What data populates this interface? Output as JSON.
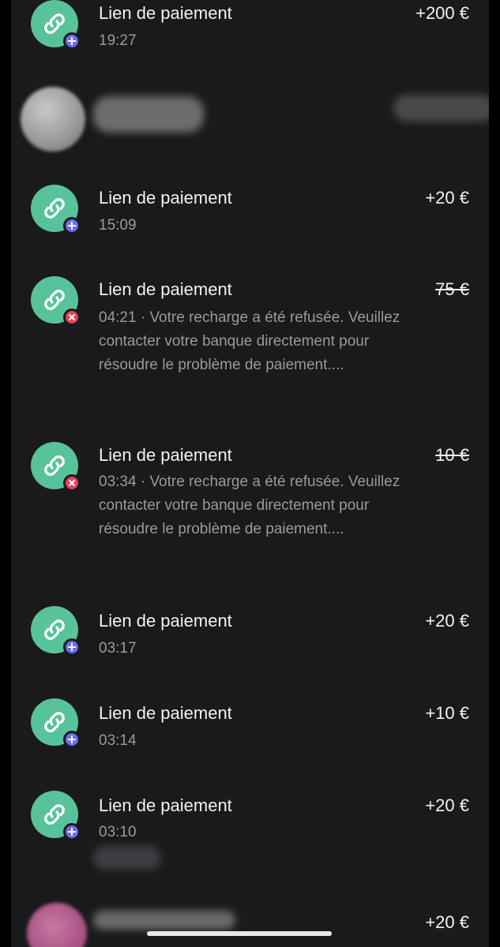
{
  "transactions": [
    {
      "title": "Lien de paiement",
      "time": "19:27",
      "amount": "+200 €",
      "status": "credit"
    },
    {
      "title": "Lien de paiement",
      "time": "15:09",
      "amount": "+20 €",
      "status": "credit"
    },
    {
      "title": "Lien de paiement",
      "time": "04:21",
      "message": "Votre recharge a été refusée. Veuillez contacter votre banque directement pour résoudre le problème de paiement....",
      "amount": "75 €",
      "status": "declined"
    },
    {
      "title": "Lien de paiement",
      "time": "03:34",
      "message": "Votre recharge a été refusée. Veuillez contacter votre banque directement pour résoudre le problème de paiement....",
      "amount": "10 €",
      "status": "declined"
    },
    {
      "title": "Lien de paiement",
      "time": "03:17",
      "amount": "+20 €",
      "status": "credit"
    },
    {
      "title": "Lien de paiement",
      "time": "03:14",
      "amount": "+10 €",
      "status": "credit"
    },
    {
      "title": "Lien de paiement",
      "time": "03:10",
      "amount": "+20 €",
      "status": "credit"
    }
  ],
  "bottom_row": {
    "amount": "+20 €"
  },
  "icons": {
    "transaction": "link-icon",
    "credit_badge": "plus-icon",
    "declined_badge": "cross-icon"
  },
  "colors": {
    "background": "#1a1a1c",
    "avatar": "#58c39a",
    "credit_badge": "#6b6ef0",
    "declined_badge": "#e0455a"
  }
}
